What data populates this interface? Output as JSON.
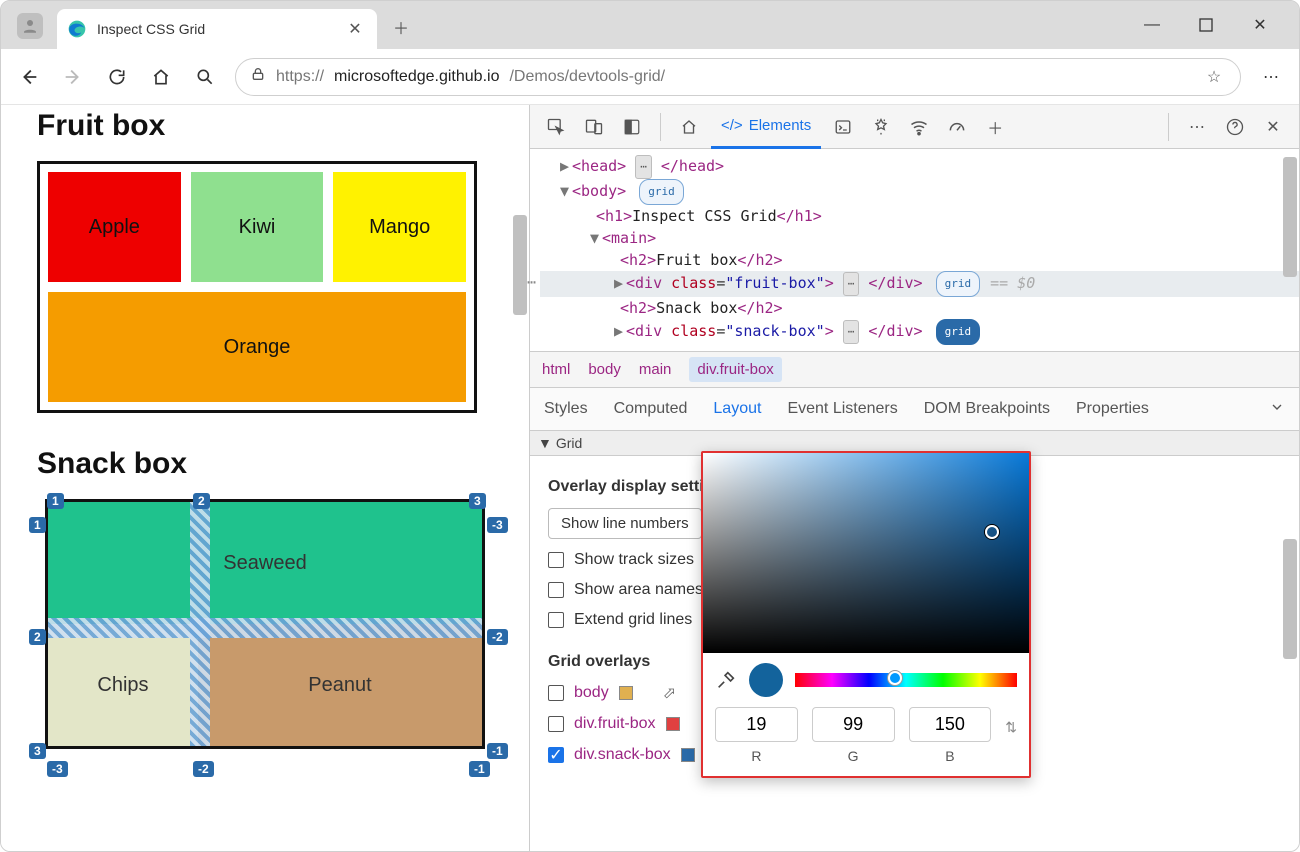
{
  "browser": {
    "tab_title": "Inspect CSS Grid",
    "url_prefix": "https://",
    "url_host": "microsoftedge.github.io",
    "url_path": "/Demos/devtools-grid/"
  },
  "page": {
    "h1a": "Fruit box",
    "fruit": {
      "apple": "Apple",
      "kiwi": "Kiwi",
      "mango": "Mango",
      "orange": "Orange"
    },
    "h1b": "Snack box",
    "snack": {
      "seaweed": "Seaweed",
      "chips": "Chips",
      "peanut": "Peanut"
    },
    "gridnums": {
      "top": [
        "1",
        "2",
        "3"
      ],
      "left": [
        "1",
        "2",
        "3"
      ],
      "right": [
        "-1",
        "-2",
        "-3"
      ],
      "bottom": [
        "-1",
        "-2",
        "-3"
      ]
    }
  },
  "devtools": {
    "elements_tab": "Elements",
    "dom": {
      "head_open": "<head>",
      "head_close": "</head>",
      "body_open": "<body>",
      "grid_pill": "grid",
      "h1": "Inspect CSS Grid",
      "main_open": "<main>",
      "h2a": "Fruit box",
      "fruit_open": "<div ",
      "fruit_class_attr": "class",
      "fruit_class_val": "\"fruit-box\"",
      "fruit_close": "</div>",
      "h2b": "Snack box",
      "snack_open": "<div ",
      "snack_class_attr": "class",
      "snack_class_val": "\"snack-box\"",
      "snack_close": "</div>",
      "eq0": "== $0"
    },
    "crumbs": [
      "html",
      "body",
      "main",
      "div.fruit-box"
    ],
    "panetabs": [
      "Styles",
      "Computed",
      "Layout",
      "Event Listeners",
      "DOM Breakpoints",
      "Properties"
    ],
    "active_panetab": "Layout",
    "grid_section": "Grid",
    "overlay_heading": "Overlay display settings",
    "select_label": "Show line numbers",
    "checks": {
      "track": "Show track sizes",
      "area": "Show area names",
      "extend": "Extend grid lines"
    },
    "overlays_heading": "Grid overlays",
    "overlays": [
      {
        "label": "body",
        "checked": false,
        "color": "#e0b050"
      },
      {
        "label": "div.fruit-box",
        "checked": false,
        "color": "#e04040"
      },
      {
        "label": "div.snack-box",
        "checked": true,
        "color": "#2a6aa8"
      }
    ]
  },
  "picker": {
    "r": "19",
    "g": "99",
    "b": "150",
    "r_label": "R",
    "g_label": "G",
    "b_label": "B"
  }
}
